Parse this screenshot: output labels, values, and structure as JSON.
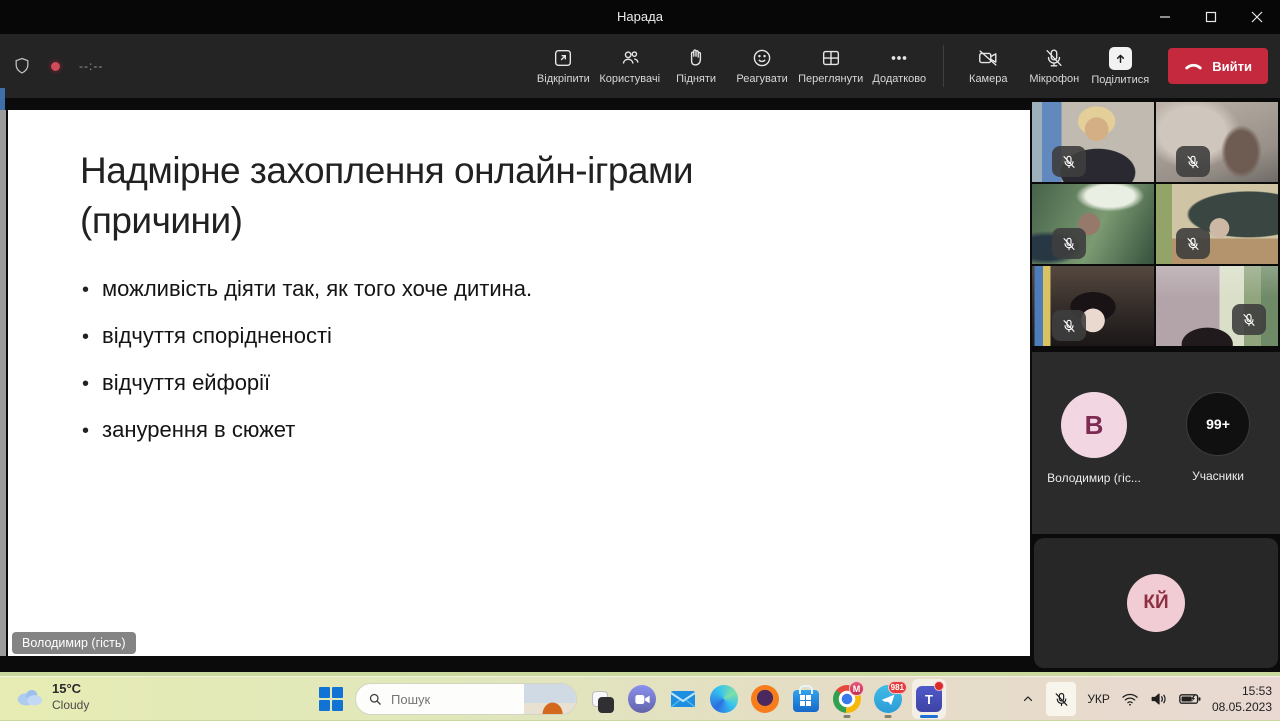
{
  "window": {
    "title": "Нарада"
  },
  "meeting_toolbar": {
    "timer": "--:--",
    "buttons": [
      {
        "label": "Відкріпити",
        "icon": "popout-icon"
      },
      {
        "label": "Користувачі",
        "icon": "people-icon"
      },
      {
        "label": "Підняти",
        "icon": "raise-hand-icon"
      },
      {
        "label": "Реагувати",
        "icon": "react-smiley-icon"
      },
      {
        "label": "Переглянути",
        "icon": "view-grid-icon"
      },
      {
        "label": "Додатково",
        "icon": "more-dots-icon"
      },
      {
        "label": "Камера",
        "icon": "camera-off-icon"
      },
      {
        "label": "Мікрофон",
        "icon": "mic-off-icon"
      },
      {
        "label": "Поділитися",
        "icon": "share-screen-icon"
      }
    ],
    "leave_label": "Вийти"
  },
  "slide": {
    "title": "Надмірне захоплення онлайн-іграми (причини)",
    "bullets": [
      "можливість діяти так, як того хоче дитина.",
      "відчуття спорідненості",
      "відчуття ейфорії",
      "занурення в сюжет"
    ],
    "presenter_label": "Володимир (гість)"
  },
  "participants_panel": {
    "muted_video_tiles": 6,
    "self_initial": "B",
    "self_name": "Володимир (гіс...",
    "participants_count": "99+",
    "participants_label": "Учасники",
    "guest_initials": "КЙ"
  },
  "taskbar": {
    "weather": {
      "temp": "15°C",
      "condition": "Cloudy"
    },
    "search_placeholder": "Пошук",
    "badges": {
      "gmail": "M",
      "telegram": "981"
    },
    "tray": {
      "language": "УКР",
      "time": "15:53",
      "date": "08.05.2023"
    }
  },
  "colors": {
    "leave_button": "#c4293d",
    "titlebar": "#070707",
    "toolbar": "#242424",
    "record_dot": "#d14b5a",
    "avatar_pink": "#f2d7e2",
    "avatar_letter": "#7d2b52",
    "taskbar_tint_left": "#e7ecb4",
    "taskbar_tint_right": "#e9d9d2",
    "teams_blue": "#5059c9"
  }
}
